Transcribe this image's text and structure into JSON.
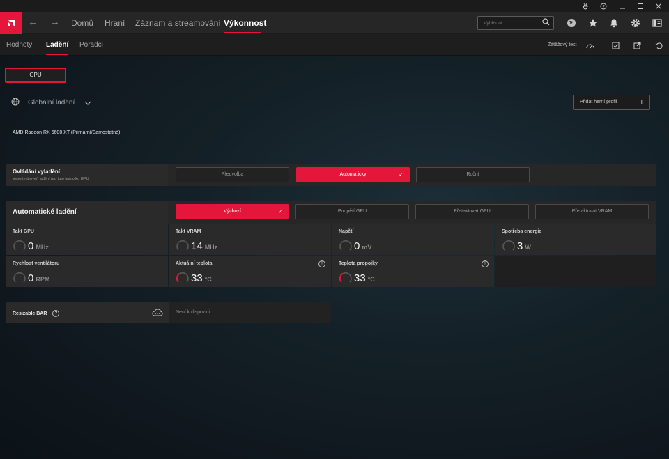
{
  "nav": {
    "items": [
      "Domů",
      "Hraní",
      "Záznam a streamování",
      "Výkonnost"
    ],
    "search_placeholder": "Vyhledat"
  },
  "subnav": {
    "tabs": [
      "Hodnoty",
      "Ladění",
      "Poradci"
    ],
    "stress_test": "Zátěžový test"
  },
  "gpu_tab": "GPU",
  "global_tuning": "Globální ladění",
  "add_profile": "Přidat herní profil",
  "gpu_name": "AMD Radeon RX 6600 XT (Primární/Samostatné)",
  "tuning_control": {
    "title": "Ovládání vyladění",
    "subtitle": "Vyberte úroveň ladění pro tuto jednotku GPU",
    "options": [
      "Předvolba",
      "Automaticky",
      "Ruční"
    ],
    "selected": "Automaticky"
  },
  "auto_tuning": {
    "title": "Automatické ladění",
    "options": [
      "Výchozí",
      "Podpětí GPU",
      "Přetaktovat GPU",
      "Přetaktovat VRAM"
    ],
    "selected": "Výchozí"
  },
  "metrics": [
    {
      "label": "Takt GPU",
      "value": "0",
      "unit": "MHz"
    },
    {
      "label": "Takt VRAM",
      "value": "14",
      "unit": "MHz"
    },
    {
      "label": "Napětí",
      "value": "0",
      "unit": "mV"
    },
    {
      "label": "Spotřeba energie",
      "value": "3",
      "unit": "W"
    },
    {
      "label": "Rychlost ventilátoru",
      "value": "0",
      "unit": "RPM"
    },
    {
      "label": "Aktuální teplota",
      "value": "33",
      "unit": "°C"
    },
    {
      "label": "Teplota propojky",
      "value": "33",
      "unit": "°C"
    }
  ],
  "resizable_bar": {
    "label": "Resizable BAR",
    "value": "Není k dispozici"
  },
  "colors": {
    "accent": "#e4173a",
    "panel": "#2a2a2a"
  }
}
